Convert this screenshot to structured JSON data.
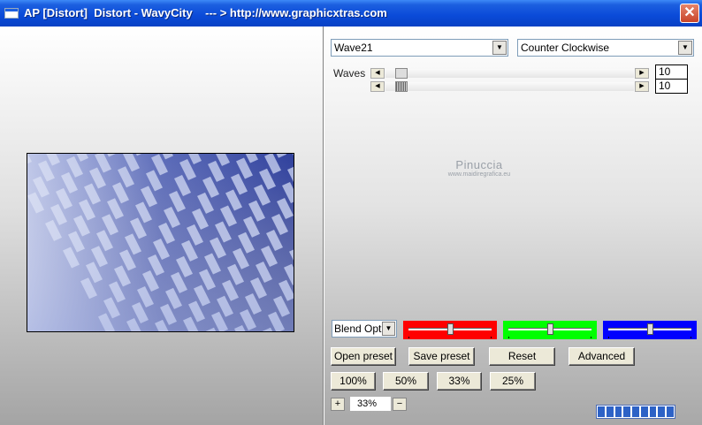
{
  "window": {
    "title": "AP [Distort]  Distort - WavyCity    --- > http://www.graphicxtras.com",
    "close_glyph": "✕"
  },
  "controls": {
    "preset_select": "Wave21",
    "direction_select": "Counter Clockwise",
    "waves_label": "Waves",
    "slider1_value": "10",
    "slider2_value": "10",
    "slider1_level": 0.04,
    "slider2_level": 0.04,
    "blend_select": "Blend Options"
  },
  "watermark": {
    "name": "Pinuccia",
    "url": "www.maidiregrafica.eu"
  },
  "color_sliders": [
    {
      "name": "red",
      "color": "#ff0000",
      "level": 0.5
    },
    {
      "name": "green",
      "color": "#00ff00",
      "level": 0.5
    },
    {
      "name": "blue",
      "color": "#0000ff",
      "level": 0.5
    }
  ],
  "buttons": {
    "open_preset": "Open preset",
    "save_preset": "Save preset",
    "reset": "Reset",
    "advanced": "Advanced",
    "zoom_100": "100%",
    "zoom_50": "50%",
    "zoom_33": "33%",
    "zoom_25": "25%"
  },
  "zoom": {
    "plus": "+",
    "value": "33%",
    "minus": "−"
  },
  "progress": {
    "segments_filled": 9,
    "segments_total": 9
  },
  "colors": {
    "title_bar": "#0a4ad8",
    "preview_dark": "#1d2a7a",
    "preview_light": "#c0c8ea"
  },
  "icons": {
    "app": "window-icon",
    "close": "close-icon",
    "left_arrow": "arrow-left-icon",
    "right_arrow": "arrow-right-icon",
    "dropdown": "chevron-down-icon"
  }
}
